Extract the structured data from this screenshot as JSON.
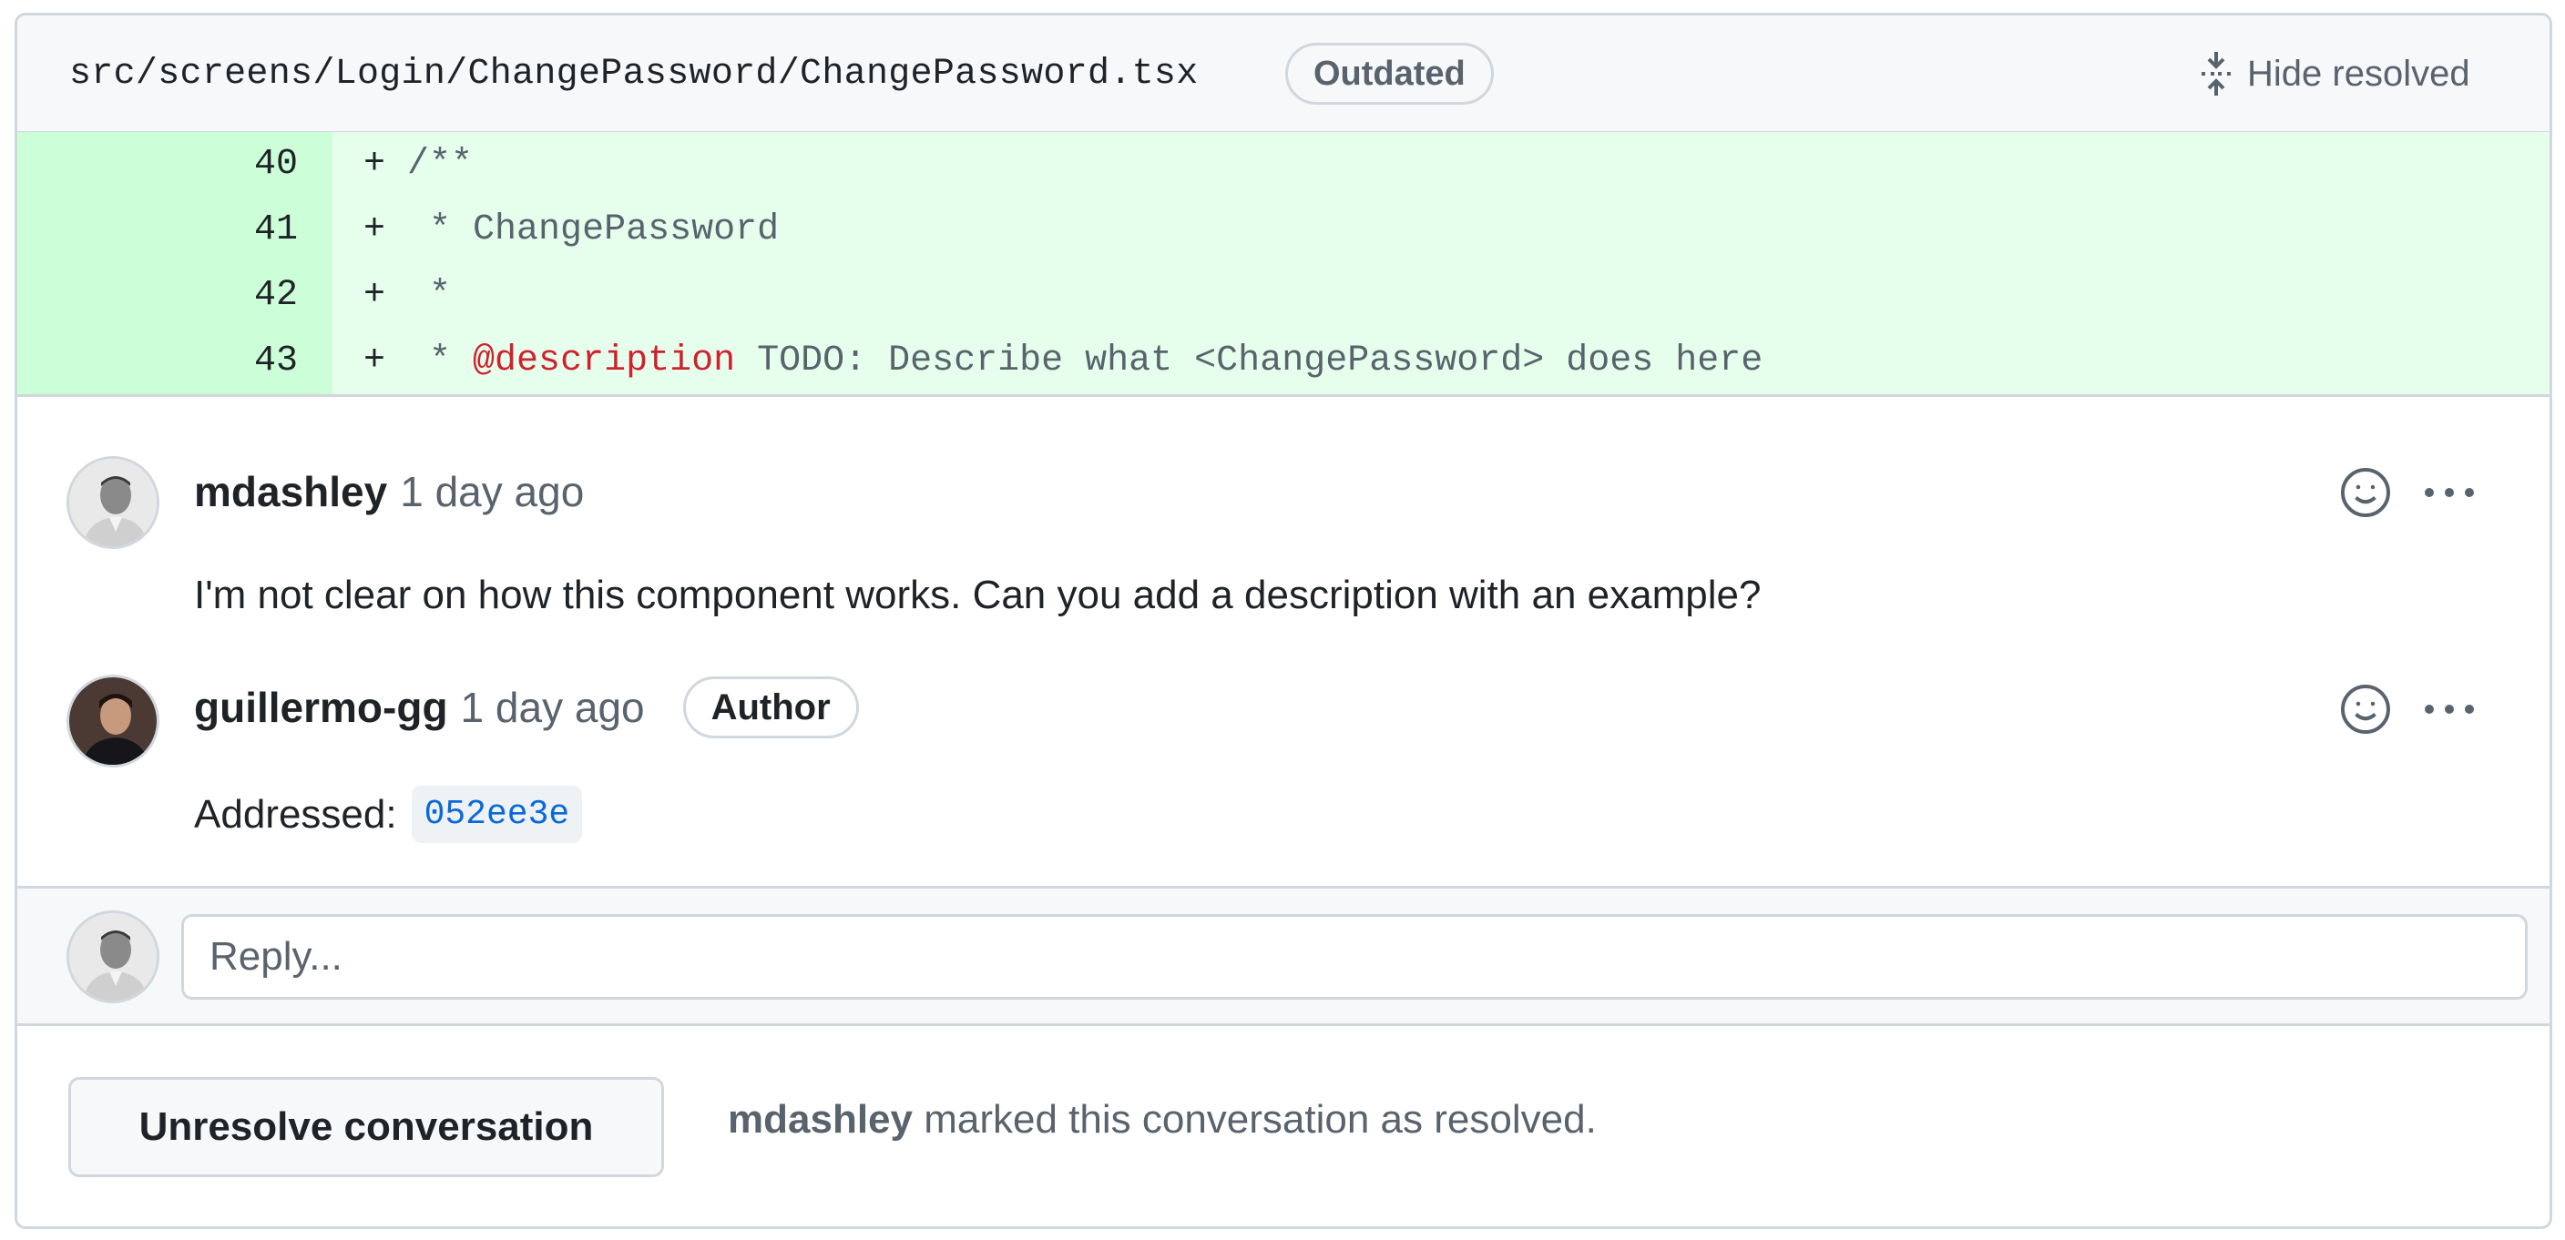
{
  "file": {
    "path": "src/screens/Login/ChangePassword/ChangePassword.tsx",
    "badge": "Outdated",
    "hide_resolved_label": "Hide resolved"
  },
  "code_lines": [
    {
      "num": "40",
      "marker": "+",
      "text": "/**"
    },
    {
      "num": "41",
      "marker": "+",
      "text": " * ChangePassword"
    },
    {
      "num": "42",
      "marker": "+",
      "text": " *"
    },
    {
      "num": "43",
      "marker": "+",
      "prefix": " * ",
      "tag": "@description",
      "text": " TODO: Describe what <ChangePassword> does here"
    }
  ],
  "comments": [
    {
      "author": "mdashley",
      "time": "1 day ago",
      "body": "I'm not clear on how this component works. Can you add a description with an example?"
    },
    {
      "author": "guillermo-gg",
      "time": "1 day ago",
      "badge": "Author",
      "body_prefix": "Addressed:",
      "commit": "052ee3e"
    }
  ],
  "reply": {
    "placeholder": "Reply..."
  },
  "resolve": {
    "button_label": "Unresolve conversation",
    "resolved_by": "mdashley",
    "resolved_text": "marked this conversation as resolved."
  },
  "colors": {
    "added_line_bg": "#e6ffec",
    "added_num_bg": "#ccffd8",
    "tag": "#cf222e",
    "link": "#0969da",
    "border": "#d0d7de"
  },
  "icons": {
    "hide_resolved": "fold-icon",
    "reaction": "smiley-icon",
    "more": "kebab-horizontal-icon"
  }
}
